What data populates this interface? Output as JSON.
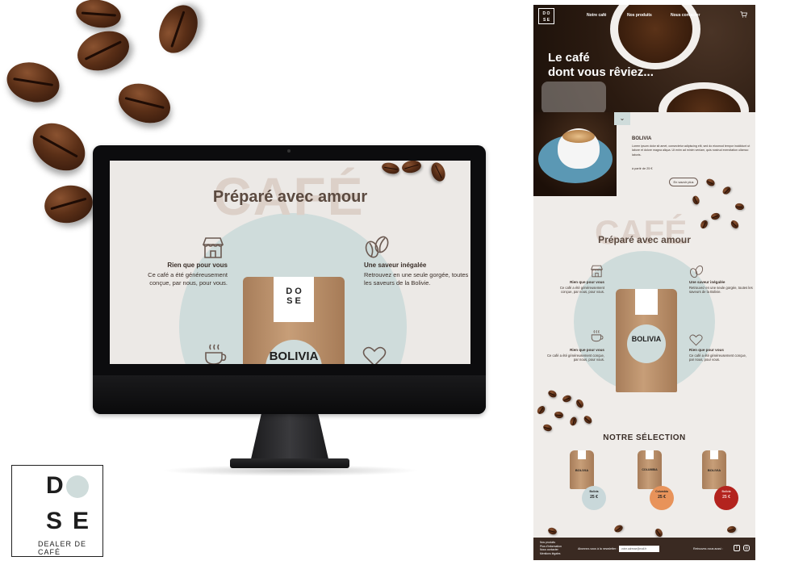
{
  "colors": {
    "brown": "#3a2e28",
    "heading": "#5b4a40",
    "mint": "#cfdcdb",
    "cream": "#efece9",
    "footer": "#3a2a22"
  },
  "monitor_site": {
    "ghost_word": "CAFÉ",
    "heading": "Préparé avec amour",
    "features": [
      {
        "icon": "shop-icon",
        "title": "Rien que pour vous",
        "text": "Ce café a été généreusement conçue, par nous, pour vous."
      },
      {
        "icon": "coffee-beans-icon",
        "title": "Une saveur inégalée",
        "text": "Retrouvez en une seule gorgée, toutes les saveurs de la Bolivie."
      },
      {
        "icon": "coffee-cup-icon"
      },
      {
        "icon": "heart-icon"
      }
    ],
    "bag": {
      "logo_top": "D  O",
      "logo_bottom": "S  E",
      "name": "BOLIVIA"
    }
  },
  "mockup_page": {
    "nav": {
      "logo_lines": [
        "D O",
        "S E"
      ],
      "links": [
        "Notre café",
        "Nos produits",
        "Nous contacter"
      ],
      "cart_icon": "cart-icon"
    },
    "hero_title_lines": [
      "Le café",
      "dont vous rêviez..."
    ],
    "chevron": "⌄",
    "intro": {
      "title": "BOLIVIA",
      "text": "Lorem ipsum dolor sit amet, consectetur adipiscing elit, sed do eiusmod tempor incididunt ut labore et dolore magna aliqua. Ut enim ad minim veniam, quis nostrud exercitation ullamco laboris.",
      "price": "à partir de 25 €",
      "button": "En savoir plus"
    },
    "ghost_word": "CAFÉ",
    "heading": "Préparé avec amour",
    "features": [
      {
        "title": "Rien que pour vous",
        "text": "Ce café a été généreusement conçue, par nous, pour vous."
      },
      {
        "title": "Une saveur inégalée",
        "text": "Retrouvez en une seule gorgée, toutes les saveurs de la Bolivie."
      },
      {
        "title": "Rien que pour vous",
        "text": "Ce café a été généreusement conçue, par nous, pour vous."
      },
      {
        "title": "Rien que pour vous",
        "text": "Ce café a été généreusement conçue, par nous, pour vous."
      }
    ],
    "bag_name": "BOLIVIA",
    "selection_title": "NOTRE SÉLECTION",
    "products": [
      {
        "name": "BOLIVIA",
        "badge_title": "Bolivia",
        "price": "25 €",
        "color": "#c9d8da"
      },
      {
        "name": "COLUMBIA",
        "badge_title": "Columbia",
        "price": "25 €",
        "color": "#e8935a"
      },
      {
        "name": "BOLIVIA",
        "badge_title": "Bolivia",
        "price": "25 €",
        "color": "#b3231e"
      }
    ],
    "footer": {
      "links": [
        "Nos produits",
        "Plus d'information",
        "Nous contacter",
        "Mentions légales"
      ],
      "newsletter_label": "Abonnez-vous à la newsletter :",
      "newsletter_placeholder": "votre.adresse@mail.fr",
      "social_label": "Retrouvez-nous aussi :"
    }
  },
  "brand": {
    "letters": [
      "D",
      "S",
      "E"
    ],
    "tagline": "DEALER DE CAFÉ"
  }
}
